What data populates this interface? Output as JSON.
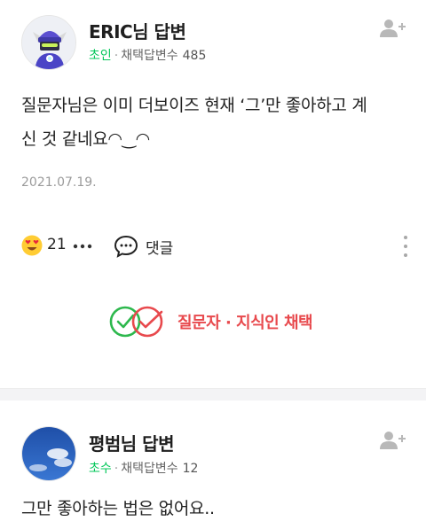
{
  "answers": [
    {
      "author": "ERIC님 답변",
      "rank": "초인",
      "adopted_label": "채택답변수",
      "adopted_count": "485",
      "body_line1": "질문자님은 이미 더보이즈 현재 ‘그’만 좋아하고 계",
      "body_line2": "신 것 같네요◠‿◠",
      "date": "2021.07.19.",
      "like_count": "21",
      "comment_label": "댓글",
      "choice_label": "질문자 · 지식인 채택"
    },
    {
      "author": "평범님 답변",
      "rank": "초수",
      "adopted_label": "채택답변수",
      "adopted_count": "12",
      "body_line1": "그만 좋아하는 법은 없어요.."
    }
  ],
  "colors": {
    "rank_green": "#03c75a",
    "choice_red": "#e8494d",
    "separator_gray": "#f3f3f5"
  },
  "icons": [
    "add-friend-icon",
    "heart-eyes-emoji-icon",
    "more-dots-icon",
    "comment-icon",
    "kebab-menu-icon",
    "adopted-check-icon"
  ]
}
